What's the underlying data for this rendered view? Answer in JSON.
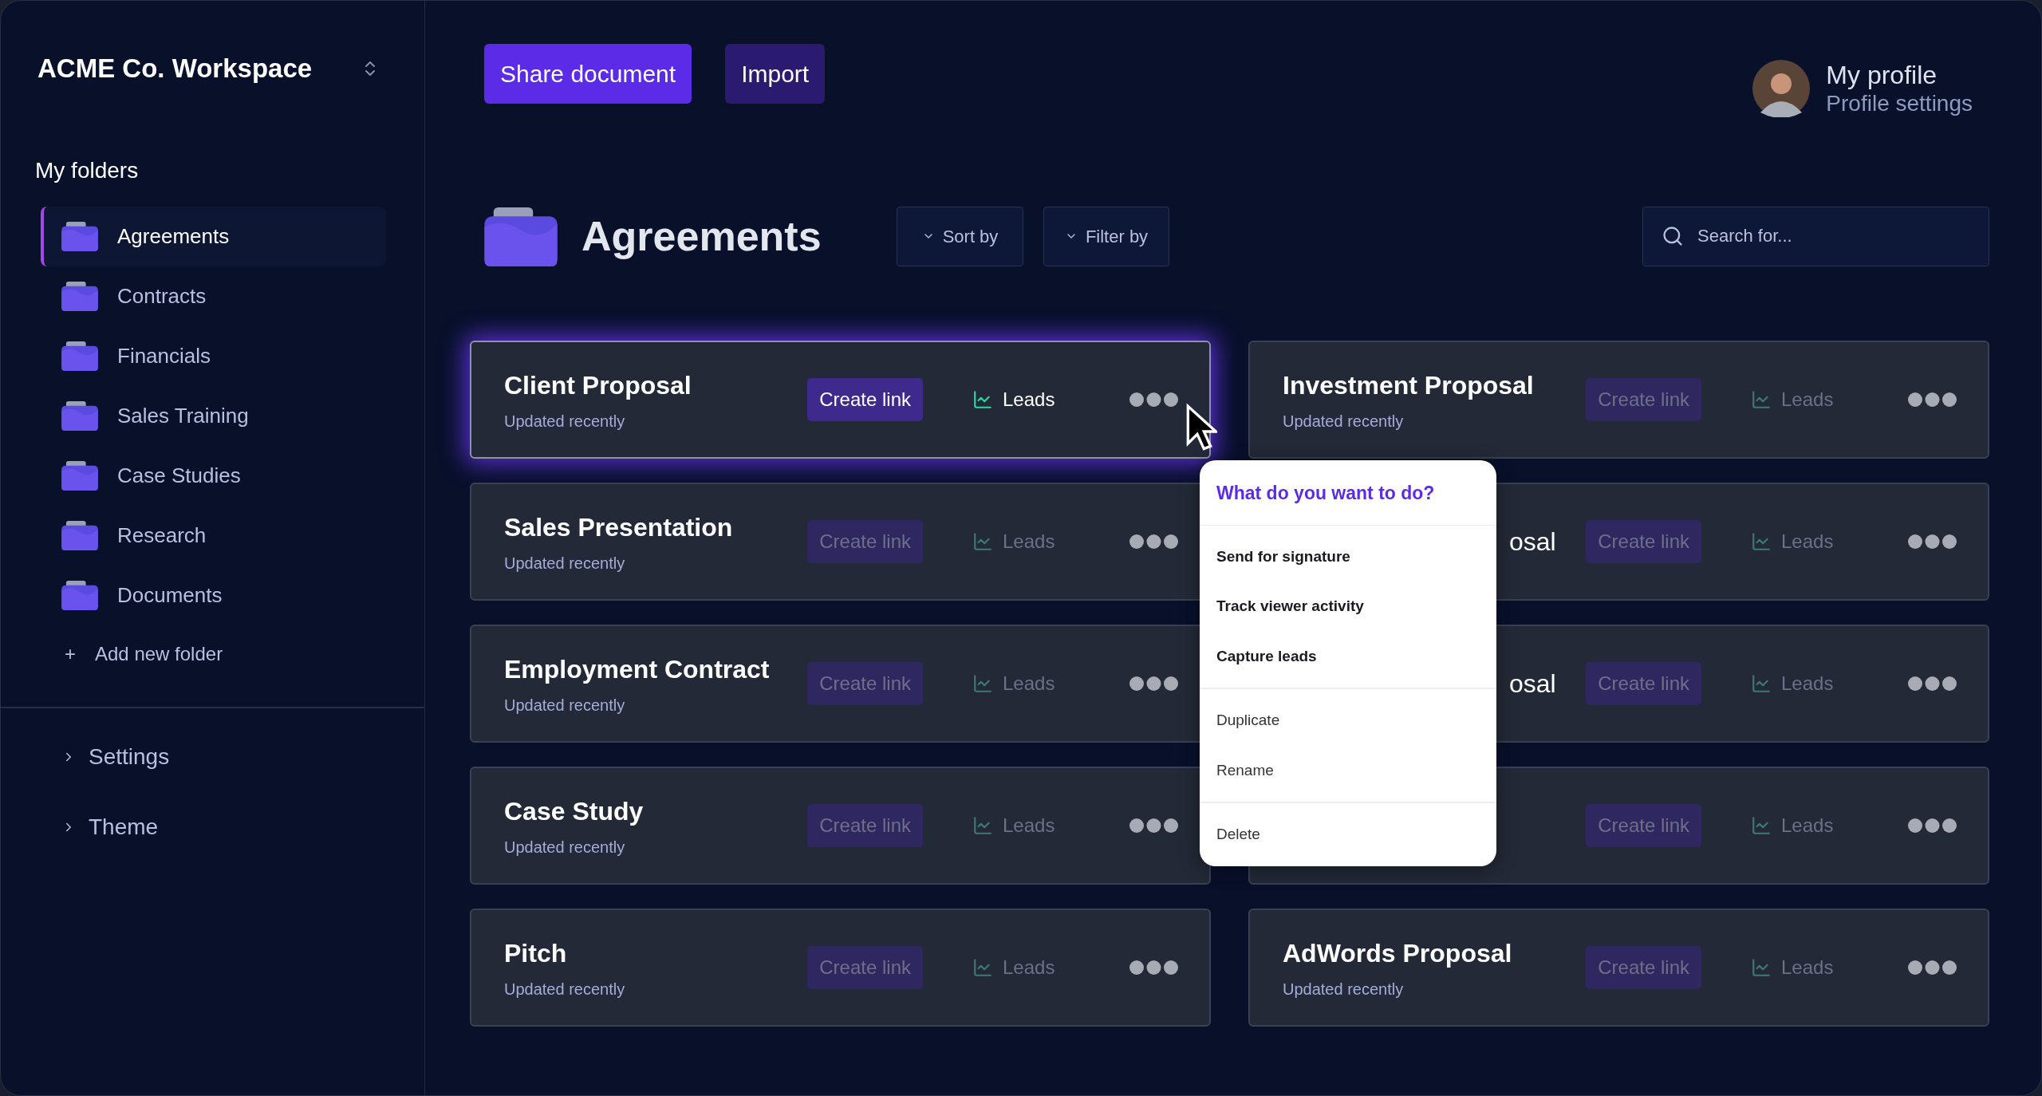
{
  "workspace": {
    "title": "ACME Co. Workspace"
  },
  "sidebar": {
    "heading": "My folders",
    "items": [
      {
        "label": "Agreements",
        "selected": true
      },
      {
        "label": "Contracts",
        "selected": false
      },
      {
        "label": "Financials",
        "selected": false
      },
      {
        "label": "Sales Training",
        "selected": false
      },
      {
        "label": "Case Studies",
        "selected": false
      },
      {
        "label": "Research",
        "selected": false
      },
      {
        "label": "Documents",
        "selected": false
      }
    ],
    "add_folder": {
      "icon": "+",
      "label": "Add new folder"
    },
    "sections": [
      {
        "label": "Settings",
        "expanded": false
      },
      {
        "label": "Theme",
        "expanded": false
      }
    ]
  },
  "toolbar": {
    "buttons": [
      {
        "label": "Share document",
        "kind": "primary"
      },
      {
        "label": "Import",
        "kind": "secondary"
      }
    ]
  },
  "profile": {
    "name": "My profile",
    "subtitle": "Profile settings"
  },
  "page": {
    "title": "Agreements",
    "sort": "Sort by",
    "filter": "Filter by",
    "search": {
      "placeholder": "Search for..."
    }
  },
  "cards": [
    {
      "kind": "full",
      "title": "Client Proposal",
      "subtitle": "Updated recently",
      "link": "Create link",
      "leads": "Leads",
      "selected": true
    },
    {
      "kind": "full",
      "title": "Investment Proposal",
      "subtitle": "Updated recently",
      "link": "Create link",
      "leads": "Leads",
      "selected": false
    },
    {
      "kind": "full",
      "title": "Sales Presentation",
      "subtitle": "Updated recently",
      "link": "Create link",
      "leads": "Leads",
      "selected": false
    },
    {
      "kind": "covered",
      "title": "osal",
      "link": "Create link",
      "leads": "Leads",
      "selected": false
    },
    {
      "kind": "full",
      "title": "Employment Contract",
      "subtitle": "Updated recently",
      "link": "Create link",
      "leads": "Leads",
      "selected": false
    },
    {
      "kind": "covered",
      "title": "osal",
      "link": "Create link",
      "leads": "Leads",
      "selected": false
    },
    {
      "kind": "full",
      "title": "Case Study",
      "subtitle": "Updated recently",
      "link": "Create link",
      "leads": "Leads",
      "selected": false
    },
    {
      "kind": "covered",
      "link": "Create link",
      "leads": "Leads",
      "selected": false
    },
    {
      "kind": "full",
      "title": "Pitch",
      "subtitle": "Updated recently",
      "link": "Create link",
      "leads": "Leads",
      "selected": false
    },
    {
      "kind": "full",
      "title": "AdWords Proposal",
      "subtitle": "Updated recently",
      "link": "Create link",
      "leads": "Leads",
      "selected": false
    }
  ],
  "menu": {
    "heading": "What do you want to do?",
    "groups": [
      {
        "kind": "strong",
        "items": [
          "Send for signature",
          "Track viewer activity",
          "Capture leads"
        ]
      },
      {
        "kind": "plain",
        "items": [
          "Duplicate",
          "Rename"
        ]
      },
      {
        "kind": "plain",
        "items": [
          "Delete"
        ]
      }
    ]
  }
}
